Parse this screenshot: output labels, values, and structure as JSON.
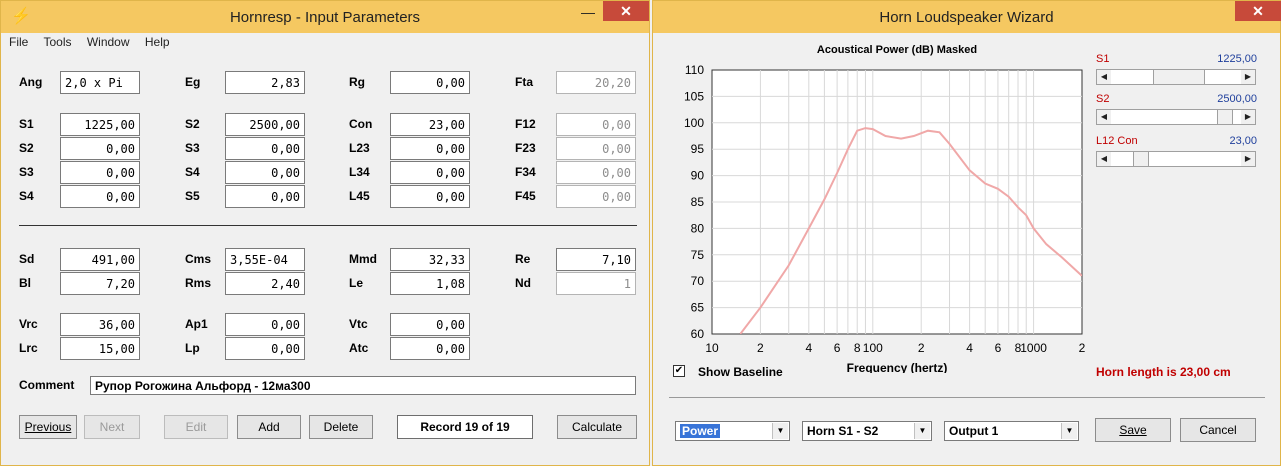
{
  "left": {
    "title": "Hornresp - Input Parameters",
    "menu": [
      "File",
      "Tools",
      "Window",
      "Help"
    ],
    "fields": {
      "Ang": "2,0 x Pi",
      "Eg": "2,83",
      "Rg": "0,00",
      "Fta": "20,20",
      "S1": "1225,00",
      "S2": "2500,00",
      "Con": "23,00",
      "F12": "0,00",
      "S2b": "0,00",
      "S3": "0,00",
      "L23": "0,00",
      "F23": "0,00",
      "S3b": "0,00",
      "S4": "0,00",
      "L34": "0,00",
      "F34": "0,00",
      "S4b": "0,00",
      "S5": "0,00",
      "L45": "0,00",
      "F45": "0,00",
      "Sd": "491,00",
      "Cms": "3,55E-04",
      "Mmd": "32,33",
      "Re": "7,10",
      "Bl": "7,20",
      "Rms": "2,40",
      "Le": "1,08",
      "Nd": "1",
      "Vrc": "36,00",
      "Ap1": "0,00",
      "Vtc": "0,00",
      "Lrc": "15,00",
      "Lp": "0,00",
      "Atc": "0,00"
    },
    "labels": {
      "Ang": "Ang",
      "Eg": "Eg",
      "Rg": "Rg",
      "Fta": "Fta",
      "S1": "S1",
      "S2": "S2",
      "Con": "Con",
      "F12": "F12",
      "S2b": "S2",
      "S3": "S3",
      "L23": "L23",
      "F23": "F23",
      "S3b": "S3",
      "S4": "S4",
      "L34": "L34",
      "F34": "F34",
      "S4b": "S4",
      "S5": "S5",
      "L45": "L45",
      "F45": "F45",
      "Sd": "Sd",
      "Cms": "Cms",
      "Mmd": "Mmd",
      "Re": "Re",
      "Bl": "Bl",
      "Rms": "Rms",
      "Le": "Le",
      "Nd": "Nd",
      "Vrc": "Vrc",
      "Ap1": "Ap1",
      "Vtc": "Vtc",
      "Lrc": "Lrc",
      "Lp": "Lp",
      "Atc": "Atc"
    },
    "comment_label": "Comment",
    "comment": "Рупор Рогожина Альфорд - 12ма300",
    "buttons": {
      "previous": "Previous",
      "next": "Next",
      "edit": "Edit",
      "add": "Add",
      "delete": "Delete",
      "record": "Record 19 of 19",
      "calculate": "Calculate"
    }
  },
  "right": {
    "title": "Horn Loudspeaker Wizard",
    "sliders": [
      {
        "label": "S1",
        "value": "1225,00"
      },
      {
        "label": "S2",
        "value": "2500,00"
      },
      {
        "label": "L12  Con",
        "value": "23,00"
      }
    ],
    "show_baseline": "Show Baseline",
    "horn_length": "Horn length is 23,00 cm",
    "selects": [
      "Power",
      "Horn S1 - S2",
      "Output 1"
    ],
    "buttons": {
      "save": "Save",
      "cancel": "Cancel"
    },
    "colors": {
      "curve": "#f0a8a8",
      "red_text": "#c00000",
      "blue_text": "#1f3f9c"
    }
  },
  "chart_data": {
    "type": "line",
    "title": "Acoustical Power (dB)   Masked",
    "xlabel": "Frequency (hertz)",
    "ylabel": "",
    "x_scale": "log",
    "xlim": [
      10,
      2000
    ],
    "ylim": [
      60,
      110
    ],
    "yticks": [
      60,
      65,
      70,
      75,
      80,
      85,
      90,
      95,
      100,
      105,
      110
    ],
    "xtick_labels": [
      "10",
      "2",
      "4",
      "6",
      "8",
      "100",
      "2",
      "4",
      "6",
      "8",
      "1000",
      "2"
    ],
    "grid": true,
    "series": [
      {
        "values": [
          [
            15,
            60
          ],
          [
            20,
            65
          ],
          [
            30,
            73
          ],
          [
            40,
            80
          ],
          [
            50,
            85.5
          ],
          [
            60,
            90.5
          ],
          [
            70,
            95
          ],
          [
            80,
            98.5
          ],
          [
            90,
            99
          ],
          [
            100,
            98.8
          ],
          [
            120,
            97.5
          ],
          [
            150,
            97
          ],
          [
            180,
            97.5
          ],
          [
            220,
            98.5
          ],
          [
            260,
            98.2
          ],
          [
            300,
            96
          ],
          [
            400,
            91
          ],
          [
            500,
            88.5
          ],
          [
            600,
            87.5
          ],
          [
            700,
            86
          ],
          [
            800,
            84
          ],
          [
            900,
            82.5
          ],
          [
            1000,
            80
          ],
          [
            1200,
            77
          ],
          [
            1500,
            74.5
          ],
          [
            2000,
            71
          ]
        ]
      }
    ]
  }
}
